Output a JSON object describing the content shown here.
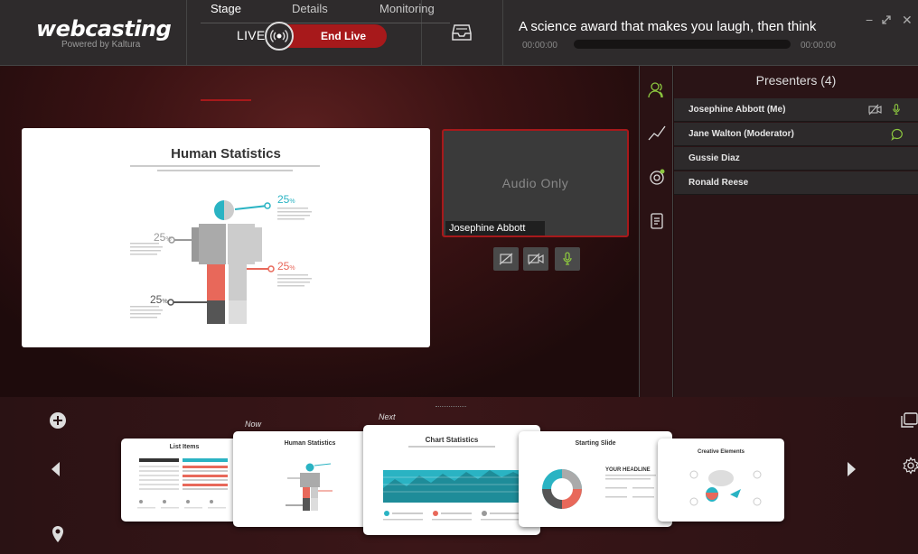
{
  "app": {
    "logo_title": "webcasting",
    "logo_subtitle": "Powered by Kaltura"
  },
  "header": {
    "live_label": "LIVE",
    "end_live_label": "End Live",
    "event_title": "A science award that makes you laugh, then think",
    "time_elapsed": "00:00:00",
    "time_total": "00:00:00",
    "progress": 0
  },
  "stage_tabs": [
    {
      "label": "Stage",
      "active": true
    },
    {
      "label": "Details",
      "active": false
    },
    {
      "label": "Monitoring",
      "active": false
    }
  ],
  "slide": {
    "title": "Human Statistics",
    "stats": [
      {
        "value": "25",
        "unit": "%",
        "color": "#2ab3c3"
      },
      {
        "value": "25",
        "unit": "%",
        "color": "#999999"
      },
      {
        "value": "25",
        "unit": "%",
        "color": "#e8685a"
      },
      {
        "value": "25",
        "unit": "%",
        "color": "#555555"
      }
    ]
  },
  "video": {
    "status_text": "Audio Only",
    "presenter_name": "Josephine Abbott"
  },
  "presenters": {
    "title": "Presenters (4)",
    "list": [
      {
        "name": "Josephine Abbott (Me)"
      },
      {
        "name": "Jane Walton (Moderator)"
      },
      {
        "name": "Gussie Diaz"
      },
      {
        "name": "Ronald Reese"
      }
    ]
  },
  "timeline": {
    "now_label": "Now",
    "next_label": "Next",
    "slides": [
      {
        "title": "List Items"
      },
      {
        "title": "Human Statistics"
      },
      {
        "title": "Chart Statistics"
      },
      {
        "title": "Starting Slide",
        "headline": "YOUR HEADLINE"
      },
      {
        "title": "Creative Elements"
      }
    ]
  },
  "colors": {
    "accent": "#a7191b",
    "mic_green": "#8cc63f",
    "teal": "#2ab3c3",
    "coral": "#e8685a"
  }
}
